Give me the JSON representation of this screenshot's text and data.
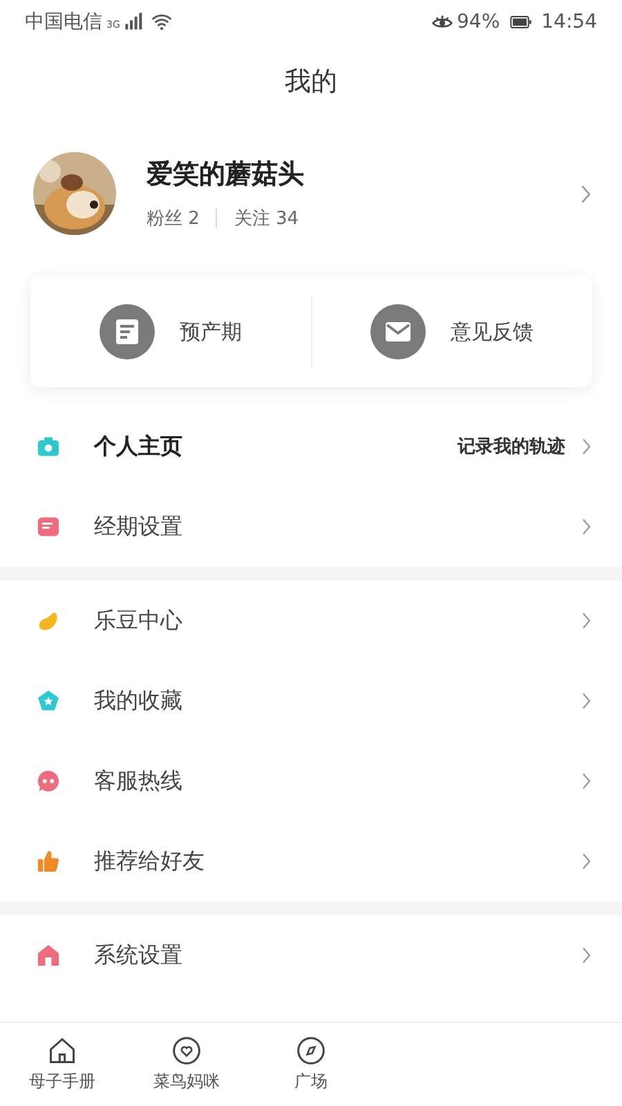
{
  "status_bar": {
    "carrier": "中国电信",
    "network": "3G",
    "battery": "94%",
    "time": "14:54"
  },
  "title": "我的",
  "profile": {
    "name": "爱笑的蘑菇头",
    "stats": [
      {
        "label": "粉丝 2"
      },
      {
        "label": "关注 34"
      }
    ]
  },
  "shortcuts": [
    {
      "label": "预产期",
      "kind": "calendar"
    },
    {
      "label": "意见反馈",
      "kind": "mail"
    }
  ],
  "sections": [
    {
      "items": [
        {
          "label": "个人主页",
          "kind": "camera",
          "color": "#2ec8cf",
          "emphasis": true,
          "hint": "记录我的轨迹"
        },
        {
          "label": "经期设置",
          "kind": "note",
          "color": "#ef6b7e",
          "emphasis": false
        }
      ]
    },
    {
      "items": [
        {
          "label": "乐豆中心",
          "kind": "bean",
          "color": "#f5b71f",
          "emphasis": false
        },
        {
          "label": "我的收藏",
          "kind": "star",
          "color": "#2ec8cf",
          "emphasis": false
        },
        {
          "label": "客服热线",
          "kind": "chat",
          "color": "#ef6b7e",
          "emphasis": false
        },
        {
          "label": "推荐给好友",
          "kind": "thumb",
          "color": "#f08a24",
          "emphasis": false
        }
      ]
    },
    {
      "items": [
        {
          "label": "系统设置",
          "kind": "house",
          "color": "#ef6b7e",
          "emphasis": false
        }
      ]
    }
  ],
  "tab_bar": [
    {
      "label": "母子手册",
      "kind": "home",
      "selected": false
    },
    {
      "label": "菜鸟妈咪",
      "kind": "heart",
      "selected": false
    },
    {
      "label": "广场",
      "kind": "compass",
      "selected": false
    }
  ]
}
